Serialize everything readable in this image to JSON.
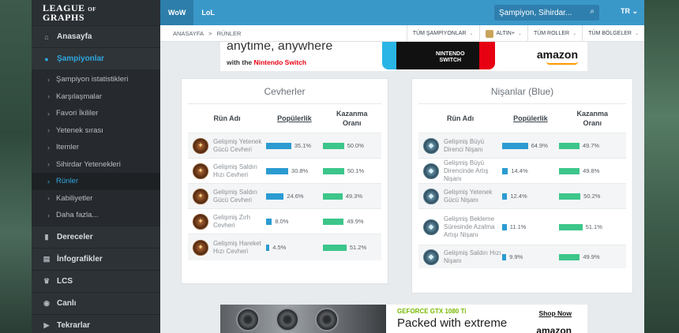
{
  "logo": {
    "line1": "LEAGUE",
    "of": "OF",
    "line2": "GRAPHS"
  },
  "sidebar": {
    "main_items": [
      {
        "label": "Anasayfa",
        "icon": "home-icon"
      },
      {
        "label": "Şampiyonlar",
        "icon": "user-icon"
      }
    ],
    "sub_items": [
      {
        "label": "Şampiyon istatistikleri"
      },
      {
        "label": "Karşılaşmalar"
      },
      {
        "label": "Favori İkililer"
      },
      {
        "label": "Yetenek sırası"
      },
      {
        "label": "Itemler"
      },
      {
        "label": "Sihirdar Yetenekleri"
      },
      {
        "label": "Rünler"
      },
      {
        "label": "Kabiliyetler"
      },
      {
        "label": "Daha fazla..."
      }
    ],
    "bottom_items": [
      {
        "label": "Dereceler",
        "icon": "chart-icon"
      },
      {
        "label": "İnfografikler",
        "icon": "document-icon"
      },
      {
        "label": "LCS",
        "icon": "trophy-icon"
      },
      {
        "label": "Canlı",
        "icon": "eye-icon"
      },
      {
        "label": "Tekrarlar",
        "icon": "play-icon"
      }
    ]
  },
  "topbar": {
    "games": [
      "WoW",
      "LoL"
    ],
    "search_placeholder": "Şampiyon, Sihirdar...",
    "lang": "TR"
  },
  "subnav": {
    "breadcrumb": [
      "ANASAYFA",
      ">",
      "RÜNLER"
    ],
    "filters": [
      "TÜM ŞAMPİYONLAR",
      "ALTIN+",
      "TÜM ROLLER",
      "TÜM BÖLGELER"
    ]
  },
  "ad_top": {
    "line1": "anytime, anywhere",
    "line2_prefix": "with the",
    "line2_brand": "Nintendo Switch",
    "switch_logo1": "NINTENDO",
    "switch_logo2": "SWITCH",
    "brand": "amazon"
  },
  "tables": {
    "left": {
      "title": "Cevherler",
      "headers": {
        "name": "Rün Adı",
        "pop": "Popülerlik",
        "win1": "Kazanma",
        "win2": "Oranı"
      },
      "rows": [
        {
          "name": "Gelişmiş Yetenek Gücü Cevheri",
          "pop": 35.1,
          "pop_label": "35.1%",
          "win": 50.0,
          "win_label": "50.0%"
        },
        {
          "name": "Gelişmiş Saldırı Hızı Cevheri",
          "pop": 30.8,
          "pop_label": "30.8%",
          "win": 50.1,
          "win_label": "50.1%"
        },
        {
          "name": "Gelişmiş Saldırı Gücü Cevheri",
          "pop": 24.6,
          "pop_label": "24.6%",
          "win": 49.3,
          "win_label": "49.3%"
        },
        {
          "name": "Gelişmiş Zırh Cevheri",
          "pop": 8.0,
          "pop_label": "8.0%",
          "win": 49.9,
          "win_label": "49.9%"
        },
        {
          "name": "Gelişmiş Hareket Hızı Cevheri",
          "pop": 4.5,
          "pop_label": "4.5%",
          "win": 51.2,
          "win_label": "51.2%"
        }
      ]
    },
    "right": {
      "title": "Nişanlar (Blue)",
      "headers": {
        "name": "Rün Adı",
        "pop": "Popülerlik",
        "win1": "Kazanma",
        "win2": "Oranı"
      },
      "rows": [
        {
          "name": "Gelişmiş Büyü Direnci Nişanı",
          "pop": 64.9,
          "pop_label": "64.9%",
          "win": 49.7,
          "win_label": "49.7%"
        },
        {
          "name": "Gelişmiş Büyü Direncinde Artış Nişanı",
          "pop": 14.4,
          "pop_label": "14.4%",
          "win": 49.8,
          "win_label": "49.8%"
        },
        {
          "name": "Gelişmiş Yetenek Gücü Nişanı",
          "pop": 12.4,
          "pop_label": "12.4%",
          "win": 50.2,
          "win_label": "50.2%"
        },
        {
          "name": "Gelişmiş Bekleme Süresinde Azalma Artışı Nişanı",
          "pop": 11.1,
          "pop_label": "11.1%",
          "win": 51.1,
          "win_label": "51.1%"
        },
        {
          "name": "Gelişmiş Saldırı Hızı Nişanı",
          "pop": 9.9,
          "pop_label": "9.9%",
          "win": 49.9,
          "win_label": "49.9%"
        }
      ]
    }
  },
  "ad_bottom": {
    "tag": "GEFORCE GTX 1080 Ti",
    "headline": "Packed with extreme",
    "cta": "Shop Now",
    "brand": "amazon"
  },
  "colors": {
    "accent": "#2fa7e0",
    "topbar": "#3a98c9",
    "pop_bar": "#2b9bd1",
    "win_bar": "#3cc68a"
  }
}
